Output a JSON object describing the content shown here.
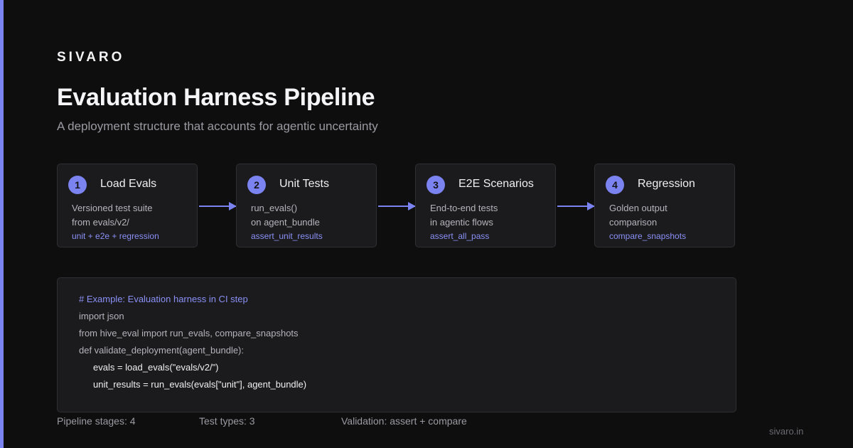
{
  "brand": "SIVARO",
  "title": "Evaluation Harness Pipeline",
  "subtitle": "A deployment structure that accounts for agentic uncertainty",
  "stages": [
    {
      "num": "1",
      "name": "Load Evals",
      "line1": "Versioned test suite",
      "line2": "from evals/v2/",
      "line3": "unit + e2e + regression"
    },
    {
      "num": "2",
      "name": "Unit Tests",
      "line1": "run_evals()",
      "line2": "on agent_bundle",
      "line3": "assert_unit_results"
    },
    {
      "num": "3",
      "name": "E2E Scenarios",
      "line1": "End-to-end tests",
      "line2": "in agentic flows",
      "line3": "assert_all_pass"
    },
    {
      "num": "4",
      "name": "Regression",
      "line1": "Golden output",
      "line2": "comparison",
      "line3": "compare_snapshots"
    }
  ],
  "code": {
    "comment": "# Example: Evaluation harness in CI step",
    "lines": [
      "import json",
      "from hive_eval import run_evals, compare_snapshots",
      "def validate_deployment(agent_bundle):",
      "evals = load_evals(\"evals/v2/\")",
      "unit_results = run_evals(evals[\"unit\"], agent_bundle)"
    ]
  },
  "stats": {
    "stages": "Pipeline stages: 4",
    "test_types": "Test types: 3",
    "validation": "Validation: assert + compare"
  },
  "footer_url": "sivaro.in",
  "colors": {
    "accent": "#7b83f0",
    "background": "#0e0e0e",
    "card": "#1b1b1e"
  }
}
